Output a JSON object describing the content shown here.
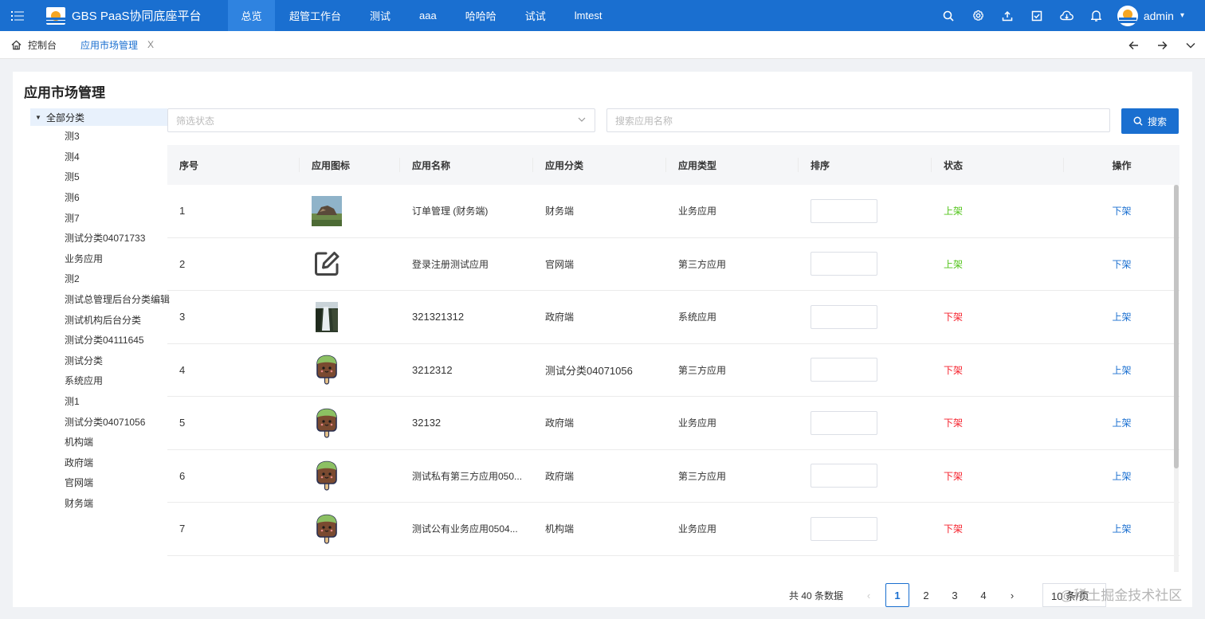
{
  "header": {
    "title": "GBS PaaS协同底座平台",
    "nav": [
      "总览",
      "超管工作台",
      "测试",
      "aaa",
      "哈哈哈",
      "试试",
      "lmtest"
    ],
    "active_nav": 0,
    "username": "admin",
    "icons": [
      "search-icon",
      "gear-icon",
      "upload-icon",
      "checkbox-icon",
      "cloud-icon",
      "bell-icon"
    ]
  },
  "tabs": {
    "home": "控制台",
    "active": "应用市场管理",
    "close": "X"
  },
  "page": {
    "title": "应用市场管理",
    "filter_placeholder": "筛选状态",
    "search_placeholder": "搜索应用名称",
    "search_button": "搜索"
  },
  "tree": {
    "root": "全部分类",
    "items": [
      "测3",
      "测4",
      "测5",
      "测6",
      "测7",
      "测试分类04071733",
      "业务应用",
      "测2",
      "测试总管理后台分类编辑",
      "测试机构后台分类",
      "测试分类04111645",
      "测试分类",
      "系统应用",
      "测1",
      "测试分类04071056",
      "机构端",
      "政府端",
      "官网端",
      "财务端"
    ]
  },
  "table": {
    "headers": [
      "序号",
      "应用图标",
      "应用名称",
      "应用分类",
      "应用类型",
      "排序",
      "状态",
      "操作"
    ],
    "rows": [
      {
        "no": "1",
        "icon": "landscape-image-icon",
        "name": "订单管理 (财务端)",
        "category": "财务端",
        "type": "业务应用",
        "status": "上架",
        "action": "下架"
      },
      {
        "no": "2",
        "icon": "edit-icon",
        "name": "登录注册测试应用",
        "category": "官网端",
        "type": "第三方应用",
        "status": "上架",
        "action": "下架"
      },
      {
        "no": "3",
        "icon": "waterfall-image-icon",
        "name": "321321312",
        "category": "政府端",
        "type": "系统应用",
        "status": "下架",
        "action": "上架"
      },
      {
        "no": "4",
        "icon": "popsicle-icon",
        "name": "3212312",
        "category": "测试分类04071056",
        "type": "第三方应用",
        "status": "下架",
        "action": "上架"
      },
      {
        "no": "5",
        "icon": "popsicle-icon",
        "name": "32132",
        "category": "政府端",
        "type": "业务应用",
        "status": "下架",
        "action": "上架"
      },
      {
        "no": "6",
        "icon": "popsicle-icon",
        "name": "测试私有第三方应用050...",
        "category": "政府端",
        "type": "第三方应用",
        "status": "下架",
        "action": "上架"
      },
      {
        "no": "7",
        "icon": "popsicle-icon",
        "name": "测试公有业务应用0504...",
        "category": "机构端",
        "type": "业务应用",
        "status": "下架",
        "action": "上架"
      }
    ]
  },
  "pagination": {
    "total": "共 40 条数据",
    "pages": [
      "1",
      "2",
      "3",
      "4"
    ],
    "current": "1",
    "page_size": "10 条/页"
  },
  "watermark": "@稀土掘金技术社区",
  "colors": {
    "primary": "#1a6fd0",
    "status_on": "#52c41a",
    "status_off": "#f5222d"
  }
}
